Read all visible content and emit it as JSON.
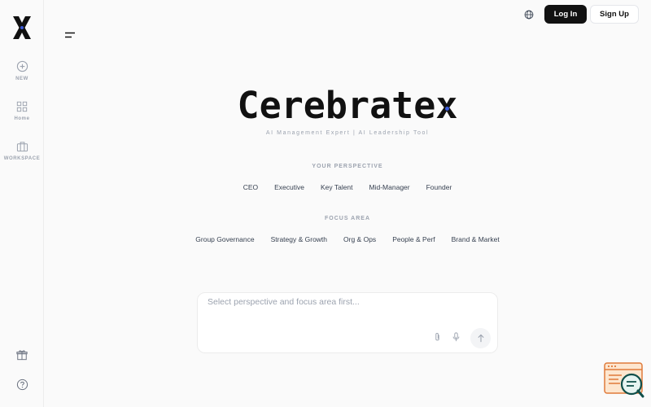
{
  "sidebar": {
    "items": [
      {
        "label": "NEW",
        "icon": "plus-circle-icon"
      },
      {
        "label": "Home",
        "icon": "grid-icon"
      },
      {
        "label": "WORKSPACE",
        "icon": "briefcase-icon"
      }
    ],
    "bottom_icons": [
      "gift-icon",
      "help-icon"
    ]
  },
  "header": {
    "login_label": "Log In",
    "signup_label": "Sign Up"
  },
  "brand": {
    "name": "Cerebratex",
    "tagline": "AI Management Expert | AI Leadership Tool"
  },
  "perspective": {
    "title": "YOUR PERSPECTIVE",
    "options": [
      "CEO",
      "Executive",
      "Key Talent",
      "Mid-Manager",
      "Founder"
    ]
  },
  "focus": {
    "title": "FOCUS AREA",
    "options": [
      "Group Governance",
      "Strategy & Growth",
      "Org & Ops",
      "People & Perf",
      "Brand & Market"
    ]
  },
  "input": {
    "placeholder": "Select perspective and focus area first..."
  },
  "colors": {
    "accent": "#3b5bdb",
    "primary_button": "#111111"
  }
}
